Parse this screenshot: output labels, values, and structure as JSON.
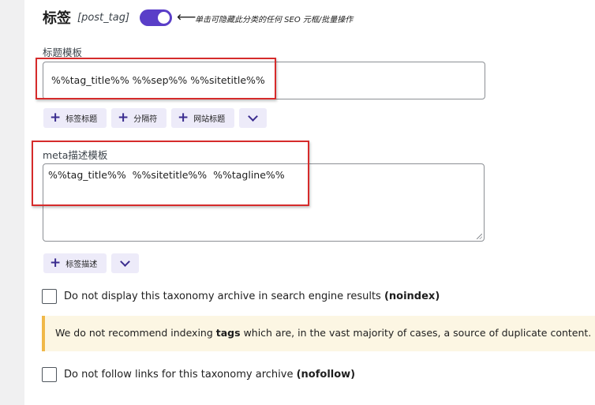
{
  "heading": {
    "title": "标签",
    "code": "[post_tag]"
  },
  "toggle": {
    "state": "on"
  },
  "hint": {
    "arrow": "⟵",
    "text": "单击可隐藏此分类的任何 SEO 元框/批量操作"
  },
  "title_template": {
    "label": "标题模板",
    "value": "%%tag_title%% %%sep%% %%sitetitle%%",
    "buttons": [
      {
        "icon": "plus-icon",
        "label": "标签标题"
      },
      {
        "icon": "plus-icon",
        "label": "分隔符"
      },
      {
        "icon": "plus-icon",
        "label": "网站标题"
      }
    ]
  },
  "meta_template": {
    "label": "meta描述模板",
    "value": "%%tag_title%%  %%sitetitle%%  %%tagline%%",
    "buttons": [
      {
        "icon": "plus-icon",
        "label": "标签描述"
      }
    ]
  },
  "noindex": {
    "checked": false,
    "text": "Do not display this taxonomy archive in search engine results",
    "bold": "(noindex)"
  },
  "notice": {
    "before": "We do not recommend indexing",
    "bold": "tags",
    "after": "which are, in the vast majority of cases, a source of duplicate content."
  },
  "nofollow": {
    "checked": false,
    "text": "Do not follow links for this taxonomy archive",
    "bold": "(nofollow)"
  },
  "colors": {
    "accent": "#5a3ec8",
    "highlight_box": "#d62b2b",
    "notice_border": "#f0b849",
    "notice_bg": "#fcf6e3",
    "button_bg": "#edebf9"
  }
}
